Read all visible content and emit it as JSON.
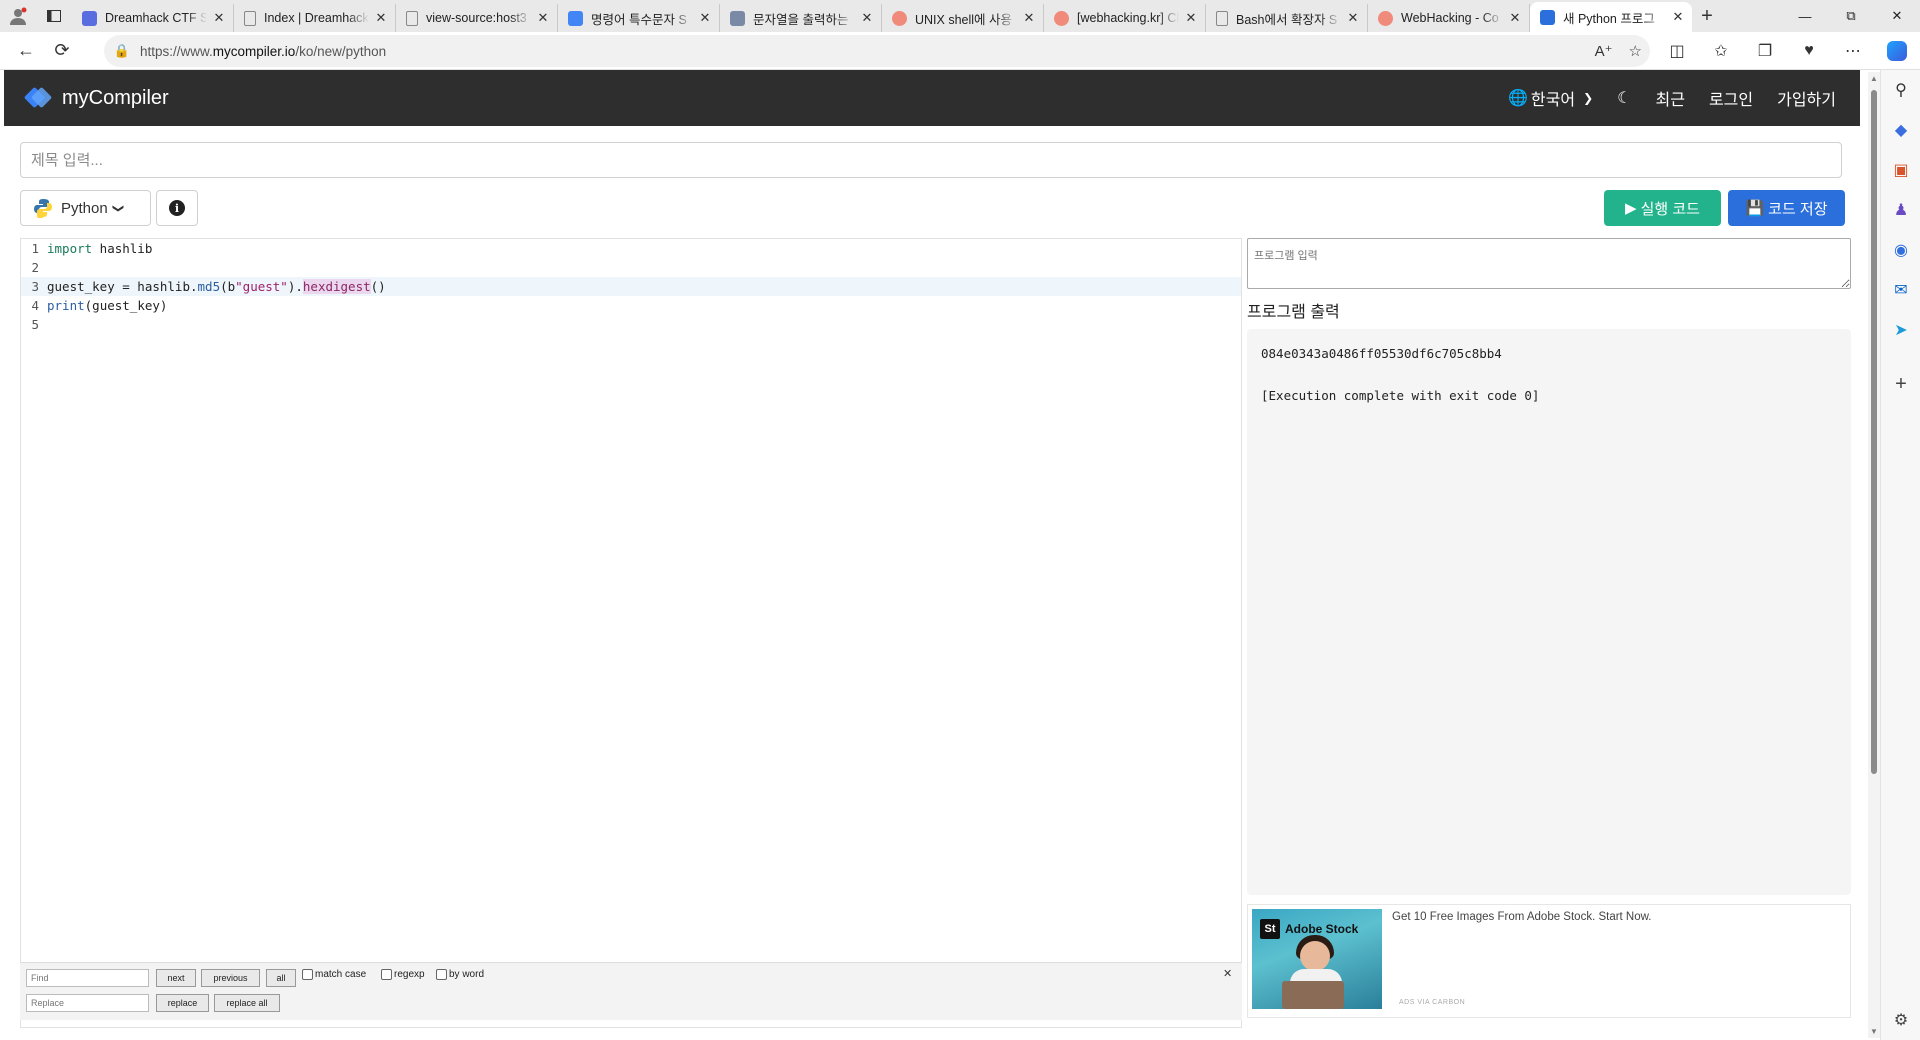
{
  "browser": {
    "tabs": [
      {
        "title": "Dreamhack CTF Se",
        "favicon": "dreamhack-icon",
        "color": "#5a6de0"
      },
      {
        "title": "Index | Dreamhack",
        "favicon": "page-icon",
        "color": "#888888"
      },
      {
        "title": "view-source:host3",
        "favicon": "page-icon",
        "color": "#888888"
      },
      {
        "title": "명령어 특수문자 S",
        "favicon": "google-icon",
        "color": "#4285f4"
      },
      {
        "title": "문자열을 출력하는",
        "favicon": "blog-icon",
        "color": "#7a8aa6"
      },
      {
        "title": "UNIX shell에 사용",
        "favicon": "tistory-icon",
        "color": "#f08a7a"
      },
      {
        "title": "[webhacking.kr] Ch",
        "favicon": "tistory-icon",
        "color": "#f08a7a"
      },
      {
        "title": "Bash에서 확장자 S",
        "favicon": "page-icon",
        "color": "#888888"
      },
      {
        "title": "WebHacking - Co",
        "favicon": "tistory-icon",
        "color": "#f08a7a"
      },
      {
        "title": "새 Python 프로그",
        "favicon": "mycompiler-icon",
        "color": "#2a6fdb",
        "active": true
      }
    ],
    "url_prefix": "https://www.",
    "url_domain": "mycompiler.io",
    "url_path": "/ko/new/python"
  },
  "site": {
    "logo_text": "myCompiler",
    "language": "한국어",
    "recent": "최근",
    "login": "로그인",
    "signup": "가입하기"
  },
  "editor_page": {
    "title_placeholder": "제목 입력...",
    "language": "Python",
    "run_label": "실행 코드",
    "save_label": "코드 저장"
  },
  "code": {
    "lines": [
      {
        "n": "1"
      },
      {
        "n": "2"
      },
      {
        "n": "3"
      },
      {
        "n": "4"
      },
      {
        "n": "5"
      }
    ],
    "t_import": "import",
    "t_hashlib": " hashlib",
    "t_line3a": "guest_key = hashlib.",
    "t_md5": "md5",
    "t_open": "(b",
    "t_str": "\"guest\"",
    "t_close": ").",
    "t_hex": "hexdigest",
    "t_parens": "()",
    "t_print": "print",
    "t_line4b": "(guest_key)"
  },
  "findbar": {
    "find_placeholder": "Find",
    "replace_placeholder": "Replace",
    "next": "next",
    "previous": "previous",
    "all": "all",
    "match_case": "match case",
    "regexp": "regexp",
    "by_word": "by word",
    "replace": "replace",
    "replace_all": "replace all"
  },
  "io": {
    "stdin_placeholder": "프로그램 입력",
    "output_title": "프로그램 출력",
    "output_lines": [
      "084e0343a0486ff05530df6c705c8bb4",
      "",
      "[Execution complete with exit code 0]"
    ]
  },
  "ad": {
    "brand": "Adobe Stock",
    "brand_mark": "St",
    "text": "Get 10 Free Images From Adobe Stock. Start Now.",
    "via": "ADS VIA CARBON"
  },
  "colors": {
    "header_bg": "#2e2e2e",
    "run": "#23b38c",
    "save": "#2a6fdb",
    "logo": "#3b82f6"
  }
}
